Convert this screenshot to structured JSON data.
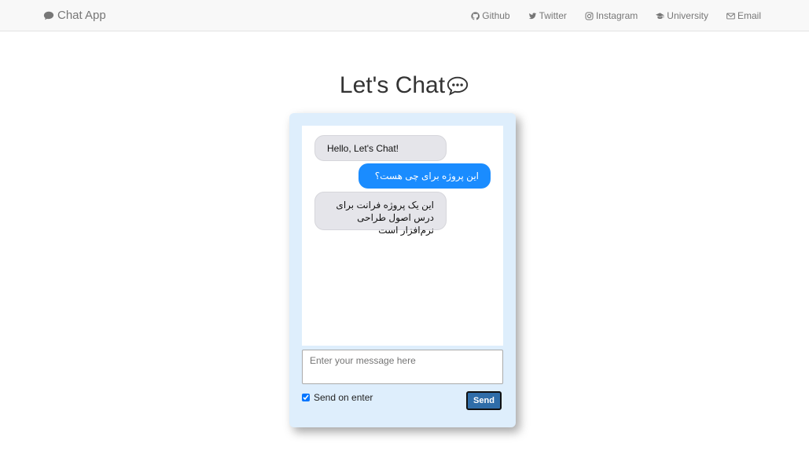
{
  "navbar": {
    "brand": "Chat App",
    "brand_icon": "comment-icon",
    "links": [
      {
        "label": "Github",
        "icon": "github-icon"
      },
      {
        "label": "Twitter",
        "icon": "twitter-icon"
      },
      {
        "label": "Instagram",
        "icon": "instagram-icon"
      },
      {
        "label": "University",
        "icon": "graduation-cap-icon"
      },
      {
        "label": "Email",
        "icon": "envelope-icon"
      }
    ]
  },
  "page": {
    "title": "Let's Chat",
    "title_icon": "chat-bubble-icon"
  },
  "chat": {
    "messages": [
      {
        "text": "Hello, Let's Chat!",
        "direction": "incoming"
      },
      {
        "text": "این پروژه برای چی هست؟",
        "direction": "outgoing"
      },
      {
        "text": "این یک پروژه فرانت برای درس اصول طراحی نرم‌افزار است",
        "direction": "incoming"
      }
    ],
    "input_placeholder": "Enter your message here",
    "input_value": "",
    "send_on_enter_label": "Send on enter",
    "send_on_enter_checked": true,
    "send_label": "Send"
  },
  "colors": {
    "navbar_bg": "#f8f8f8",
    "card_bg": "#deeefc",
    "incoming_bubble": "#e5e5ea",
    "outgoing_bubble": "#1a8cff",
    "send_button": "#2f6da8"
  }
}
